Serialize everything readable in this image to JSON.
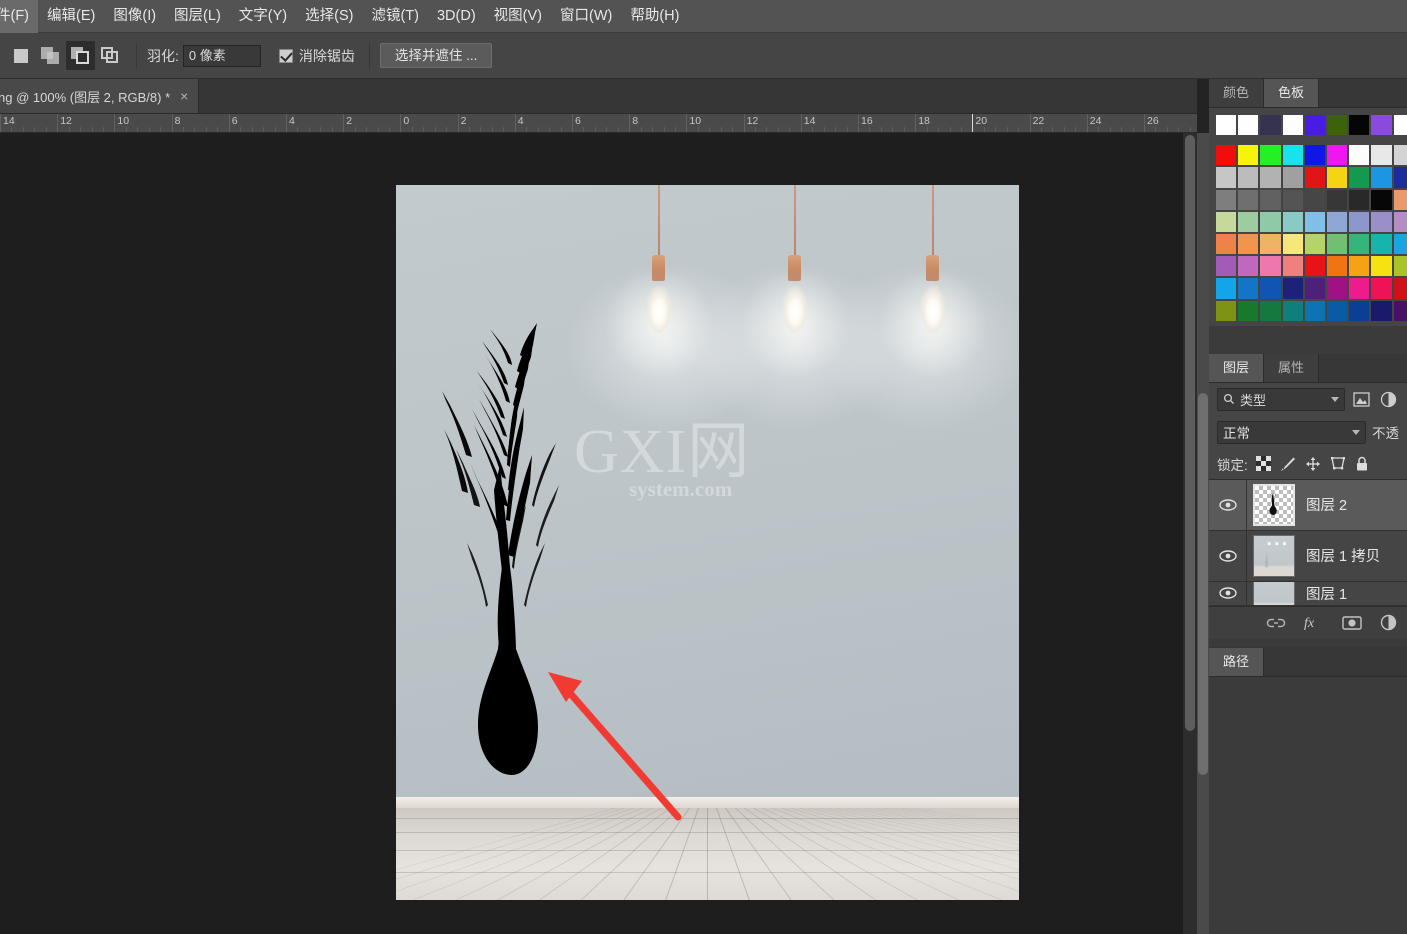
{
  "app": {
    "name": "Adobe Photoshop"
  },
  "menubar": {
    "items": [
      {
        "label": "件(F)",
        "name": "menu-file"
      },
      {
        "label": "编辑(E)",
        "name": "menu-edit"
      },
      {
        "label": "图像(I)",
        "name": "menu-image"
      },
      {
        "label": "图层(L)",
        "name": "menu-layer"
      },
      {
        "label": "文字(Y)",
        "name": "menu-type"
      },
      {
        "label": "选择(S)",
        "name": "menu-select"
      },
      {
        "label": "滤镜(T)",
        "name": "menu-filter"
      },
      {
        "label": "3D(D)",
        "name": "menu-3d"
      },
      {
        "label": "视图(V)",
        "name": "menu-view"
      },
      {
        "label": "窗口(W)",
        "name": "menu-window"
      },
      {
        "label": "帮助(H)",
        "name": "menu-help"
      }
    ]
  },
  "options_bar": {
    "selection_modes": [
      {
        "name": "new-selection",
        "active": false
      },
      {
        "name": "add-to-selection",
        "active": false
      },
      {
        "name": "subtract-from-selection",
        "active": true
      },
      {
        "name": "intersect-selection",
        "active": false
      }
    ],
    "feather_label": "羽化:",
    "feather_value": "0 像素",
    "antialias_label": "消除锯齿",
    "antialias_checked": true,
    "select_and_mask_label": "选择并遮住 ..."
  },
  "document_tab": {
    "title": "ng @ 100% (图层 2, RGB/8) *",
    "close": "×"
  },
  "ruler": {
    "unit_marks": [
      "14",
      "12",
      "10",
      "8",
      "6",
      "4",
      "2",
      "0",
      "2",
      "4",
      "6",
      "8",
      "10",
      "12",
      "14",
      "16",
      "18",
      "20",
      "22",
      "24",
      "26"
    ],
    "marker_at": "20"
  },
  "canvas": {
    "zoom": "100%",
    "watermark_main": "GXI网",
    "watermark_sub": "system.com",
    "wall_color": "#bdc5c9",
    "floor_color": "#e2ded9",
    "annotation_arrow_color": "#f03a32",
    "lamp_count": 3
  },
  "color_dock": {
    "tabs": [
      {
        "label": "颜色",
        "name": "tab-color",
        "active": false
      },
      {
        "label": "色板",
        "name": "tab-swatches",
        "active": true
      }
    ],
    "swatch_rows": [
      [
        "#ffffff",
        "#fefefe",
        "#343350",
        "#fdfdfd",
        "#4b1be6",
        "#3c6309",
        "#050505",
        "#8a4ae0",
        "#ffffff"
      ],
      [
        "#f20c0c",
        "#f7f30c",
        "#25f025",
        "#1ae2ea",
        "#1015e8",
        "#ef17ef",
        "#fdfdfd",
        "#e8e8e8",
        "#d4d4d4"
      ],
      [
        "#c6c6c6",
        "#bcbcbc",
        "#b2b2b2",
        "#a0a0a0",
        "#e01616",
        "#f5d410",
        "#139a4e",
        "#1b96e0",
        "#1d2c9c"
      ],
      [
        "#7e7e7e",
        "#6f6f6f",
        "#616161",
        "#545454",
        "#464646",
        "#373737",
        "#292929",
        "#070707",
        "#eb9a6c"
      ],
      [
        "#c4d99a",
        "#9fcba0",
        "#8ecaa8",
        "#88cbc4",
        "#80c0e8",
        "#8fa7d4",
        "#8e97cd",
        "#9a8fc8",
        "#b38ec4"
      ],
      [
        "#ef8248",
        "#f0944e",
        "#f0b263",
        "#f5e77c",
        "#b4d46a",
        "#71c071",
        "#35b57a",
        "#17b4ab",
        "#1aa4e0"
      ],
      [
        "#a35bb8",
        "#c068bd",
        "#ee78ae",
        "#f0807f",
        "#e61414",
        "#f07412",
        "#f5a313",
        "#f7e211",
        "#a9c425"
      ],
      [
        "#12a6e8",
        "#1375c6",
        "#1155b2",
        "#1c2278",
        "#4d217a",
        "#a01186",
        "#ed1b8c",
        "#ef1257",
        "#d0111a"
      ],
      [
        "#7e9213",
        "#177a2a",
        "#14783f",
        "#0e7f7a",
        "#0d74b4",
        "#0b5aa6",
        "#0b3f96",
        "#191a6b",
        "#4a1066"
      ]
    ]
  },
  "layers_panel": {
    "tabs": [
      {
        "label": "图层",
        "name": "tab-layers",
        "active": true
      },
      {
        "label": "属性",
        "name": "tab-properties",
        "active": false
      }
    ],
    "filter_label": "类型",
    "blend_mode": "正常",
    "opacity_label": "不透",
    "lock_label": "锁定:",
    "lock_icons": [
      "transparency-lock",
      "brush-lock",
      "move-lock",
      "artboard-lock",
      "all-lock"
    ],
    "layers": [
      {
        "name": "图层 2",
        "selected": true,
        "visible": true,
        "thumb": "transparent"
      },
      {
        "name": "图层 1 拷贝",
        "selected": false,
        "visible": true,
        "thumb": "room"
      },
      {
        "name": "图层 1",
        "selected": false,
        "visible": true,
        "thumb": "room"
      }
    ],
    "footer_icons": [
      "link-icon",
      "fx-icon",
      "layer-mask-icon",
      "adjustment-icon"
    ]
  },
  "paths_panel": {
    "tabs": [
      {
        "label": "路径",
        "name": "tab-paths",
        "active": true
      }
    ]
  }
}
